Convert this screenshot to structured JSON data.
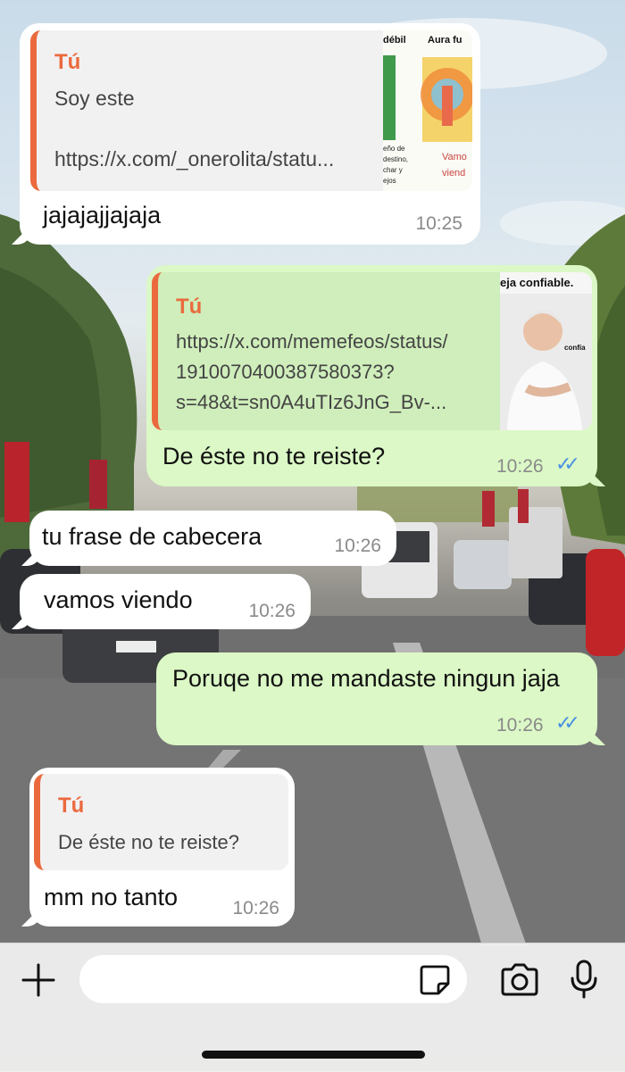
{
  "colors": {
    "incoming": "#ffffff",
    "outgoing": "#dbf8c6",
    "quote_accent": "#ea6a3e",
    "read_ticks": "#4a90e2"
  },
  "messages": [
    {
      "side": "in",
      "quote": {
        "author": "Tú",
        "line1": "Soy este",
        "line2": "https://x.com/_onerolita/statu...",
        "thumb": {
          "heading_left": "débil",
          "heading_right": "Aura fu",
          "small1": "eño de",
          "small2": "destino,",
          "small3": "char y",
          "small4": "ejos",
          "red1": "Vamo",
          "red2": "viend"
        }
      },
      "text": "jajajajjajaja",
      "time": "10:25"
    },
    {
      "side": "out",
      "quote": {
        "author": "Tú",
        "line1": "https://x.com/memefeos/status/",
        "line2": "1910070400387580373?",
        "line3": "s=48&t=sn0A4uTIz6JnG_Bv-...",
        "thumb": {
          "heading": "eja confiable.",
          "side": "confía"
        }
      },
      "text": "De éste no te reiste?",
      "time": "10:26",
      "status": "read"
    },
    {
      "side": "in",
      "text": "tu frase de cabecera",
      "time": "10:26"
    },
    {
      "side": "in",
      "text": "vamos viendo",
      "time": "10:26"
    },
    {
      "side": "out",
      "text": "Poruqe no me mandaste ningun jaja",
      "time": "10:26",
      "status": "read"
    },
    {
      "side": "in",
      "quote": {
        "author": "Tú",
        "line1": "De éste no te reiste?"
      },
      "text": "mm no tanto",
      "time": "10:26"
    }
  ],
  "composer": {
    "attach_icon": "plus-icon",
    "sticker_icon": "sticker-icon",
    "camera_icon": "camera-icon",
    "mic_icon": "microphone-icon",
    "input_value": ""
  }
}
